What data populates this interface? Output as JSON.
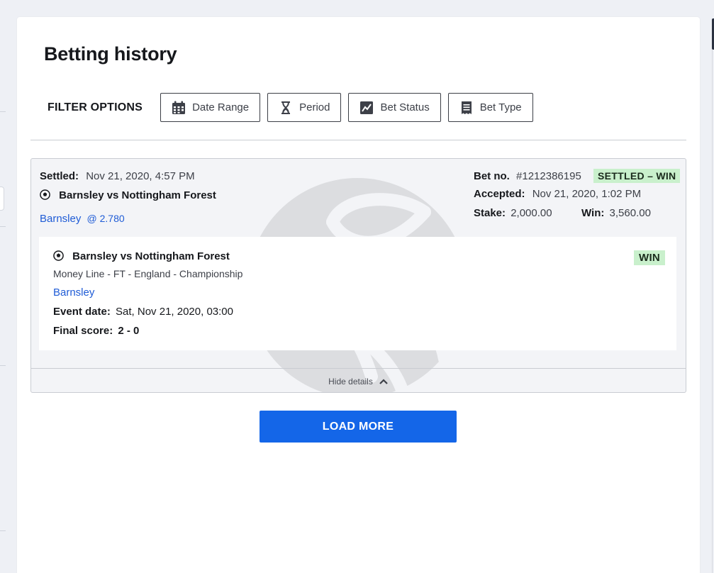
{
  "page": {
    "title": "Betting history"
  },
  "filters": {
    "label": "FILTER OPTIONS",
    "buttons": [
      {
        "label": "Date Range",
        "icon": "calendar-icon"
      },
      {
        "label": "Period",
        "icon": "hourglass-icon"
      },
      {
        "label": "Bet Status",
        "icon": "chart-icon"
      },
      {
        "label": "Bet Type",
        "icon": "receipt-icon"
      }
    ]
  },
  "bet": {
    "settled_label": "Settled:",
    "settled_value": "Nov 21, 2020, 4:57 PM",
    "match": "Barnsley vs Nottingham Forest",
    "selection": "Barnsley",
    "odds": "@ 2.780",
    "bet_no_label": "Bet no.",
    "bet_no_value": "#1212386195",
    "status_badge": "SETTLED – WIN",
    "accepted_label": "Accepted:",
    "accepted_value": "Nov 21, 2020, 1:02 PM",
    "stake_label": "Stake:",
    "stake_value": "2,000.00",
    "win_label": "Win:",
    "win_value": "3,560.00",
    "detail": {
      "match": "Barnsley vs Nottingham Forest",
      "market": "Money Line - FT - England - Championship",
      "selection": "Barnsley",
      "event_date_label": "Event date:",
      "event_date_value": "Sat, Nov 21, 2020, 03:00",
      "final_score_label": "Final score:",
      "final_score_value": "2 - 0",
      "result_badge": "WIN"
    },
    "hide_details": "Hide details"
  },
  "load_more": "LOAD MORE",
  "colors": {
    "accent": "#1466e8",
    "link": "#1f5cd6",
    "win_badge": "#c9f0cc"
  }
}
